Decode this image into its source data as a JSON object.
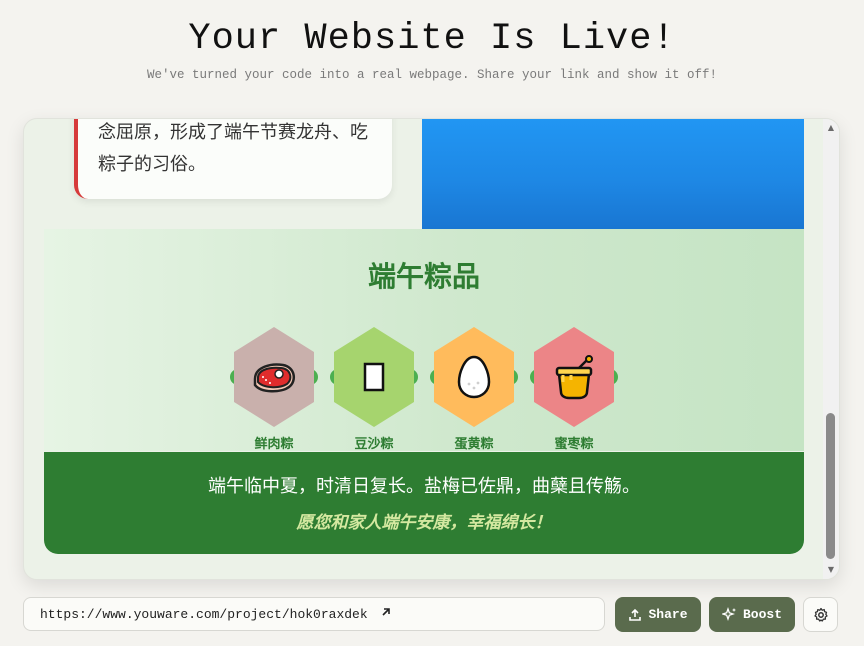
{
  "header": {
    "title": "Your Website Is Live!",
    "subtitle": "We've turned your code into a real webpage. Share your link and show it off!"
  },
  "preview": {
    "card_text": "念屈原，形成了端午节赛龙舟、吃粽子的习俗。",
    "section_title": "端午粽品",
    "items": [
      {
        "label": "鲜肉粽",
        "icon": "meat-icon",
        "color": "#c9b0ac"
      },
      {
        "label": "豆沙粽",
        "icon": "bean-box-icon",
        "color": "#a6d46e"
      },
      {
        "label": "蛋黄粽",
        "icon": "egg-icon",
        "color": "#ffbb5c"
      },
      {
        "label": "蜜枣粽",
        "icon": "honey-pot-icon",
        "color": "#ec8587"
      }
    ],
    "footer_line1": "端午临中夏，时清日复长。盐梅已佐鼎，曲蘖且传觞。",
    "footer_line2": "愿您和家人端午安康，幸福绵长！"
  },
  "bottom_bar": {
    "url": "https://www.youware.com/project/hok0raxdek",
    "share_label": "Share",
    "boost_label": "Boost"
  },
  "colors": {
    "accent_green": "#2e7d32",
    "button_bg": "#5a6b4d",
    "blue_box": "#1e88e5",
    "card_border": "#d63a3a"
  }
}
